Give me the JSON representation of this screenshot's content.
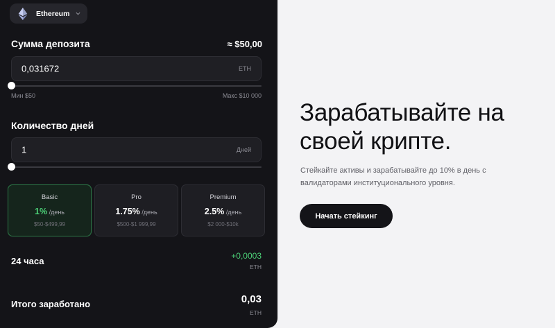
{
  "network": {
    "label": "Ethereum",
    "icon": "ethereum-icon"
  },
  "deposit": {
    "title": "Сумма депозита",
    "usd_equiv": "≈ $50,00",
    "value": "0,031672",
    "unit": "ETH",
    "min": "Мин $50",
    "max": "Макс $10 000",
    "slider_position": 0
  },
  "days": {
    "title": "Количество дней",
    "value": "1",
    "unit": "Дней",
    "slider_position": 0
  },
  "plans": [
    {
      "name": "Basic",
      "rate": "1%",
      "per": " /день",
      "range": "$50-$499,99",
      "active": true
    },
    {
      "name": "Pro",
      "rate": "1.75%",
      "per": " /день",
      "range": "$500-$1 999,99",
      "active": false
    },
    {
      "name": "Premium",
      "rate": "2.5%",
      "per": " /день",
      "range": "$2 000-$10k",
      "active": false
    }
  ],
  "earnings_24h": {
    "label": "24 часа",
    "value": "+0,0003",
    "unit": "ETH"
  },
  "total_earned": {
    "label": "Итого заработано",
    "value": "0,03",
    "unit": "ETH"
  },
  "hero": {
    "title_line1": "Зарабатывайте на",
    "title_line2": "своей крипте.",
    "subtitle_line1": "Стейкайте активы и зарабатывайте до 10% в день с",
    "subtitle_line2": "валидаторами институционального уровня.",
    "cta_label": "Начать стейкинг"
  },
  "colors": {
    "panel_bg": "#141418",
    "accent_green": "#4cd278",
    "page_bg": "#f3f3f5"
  }
}
